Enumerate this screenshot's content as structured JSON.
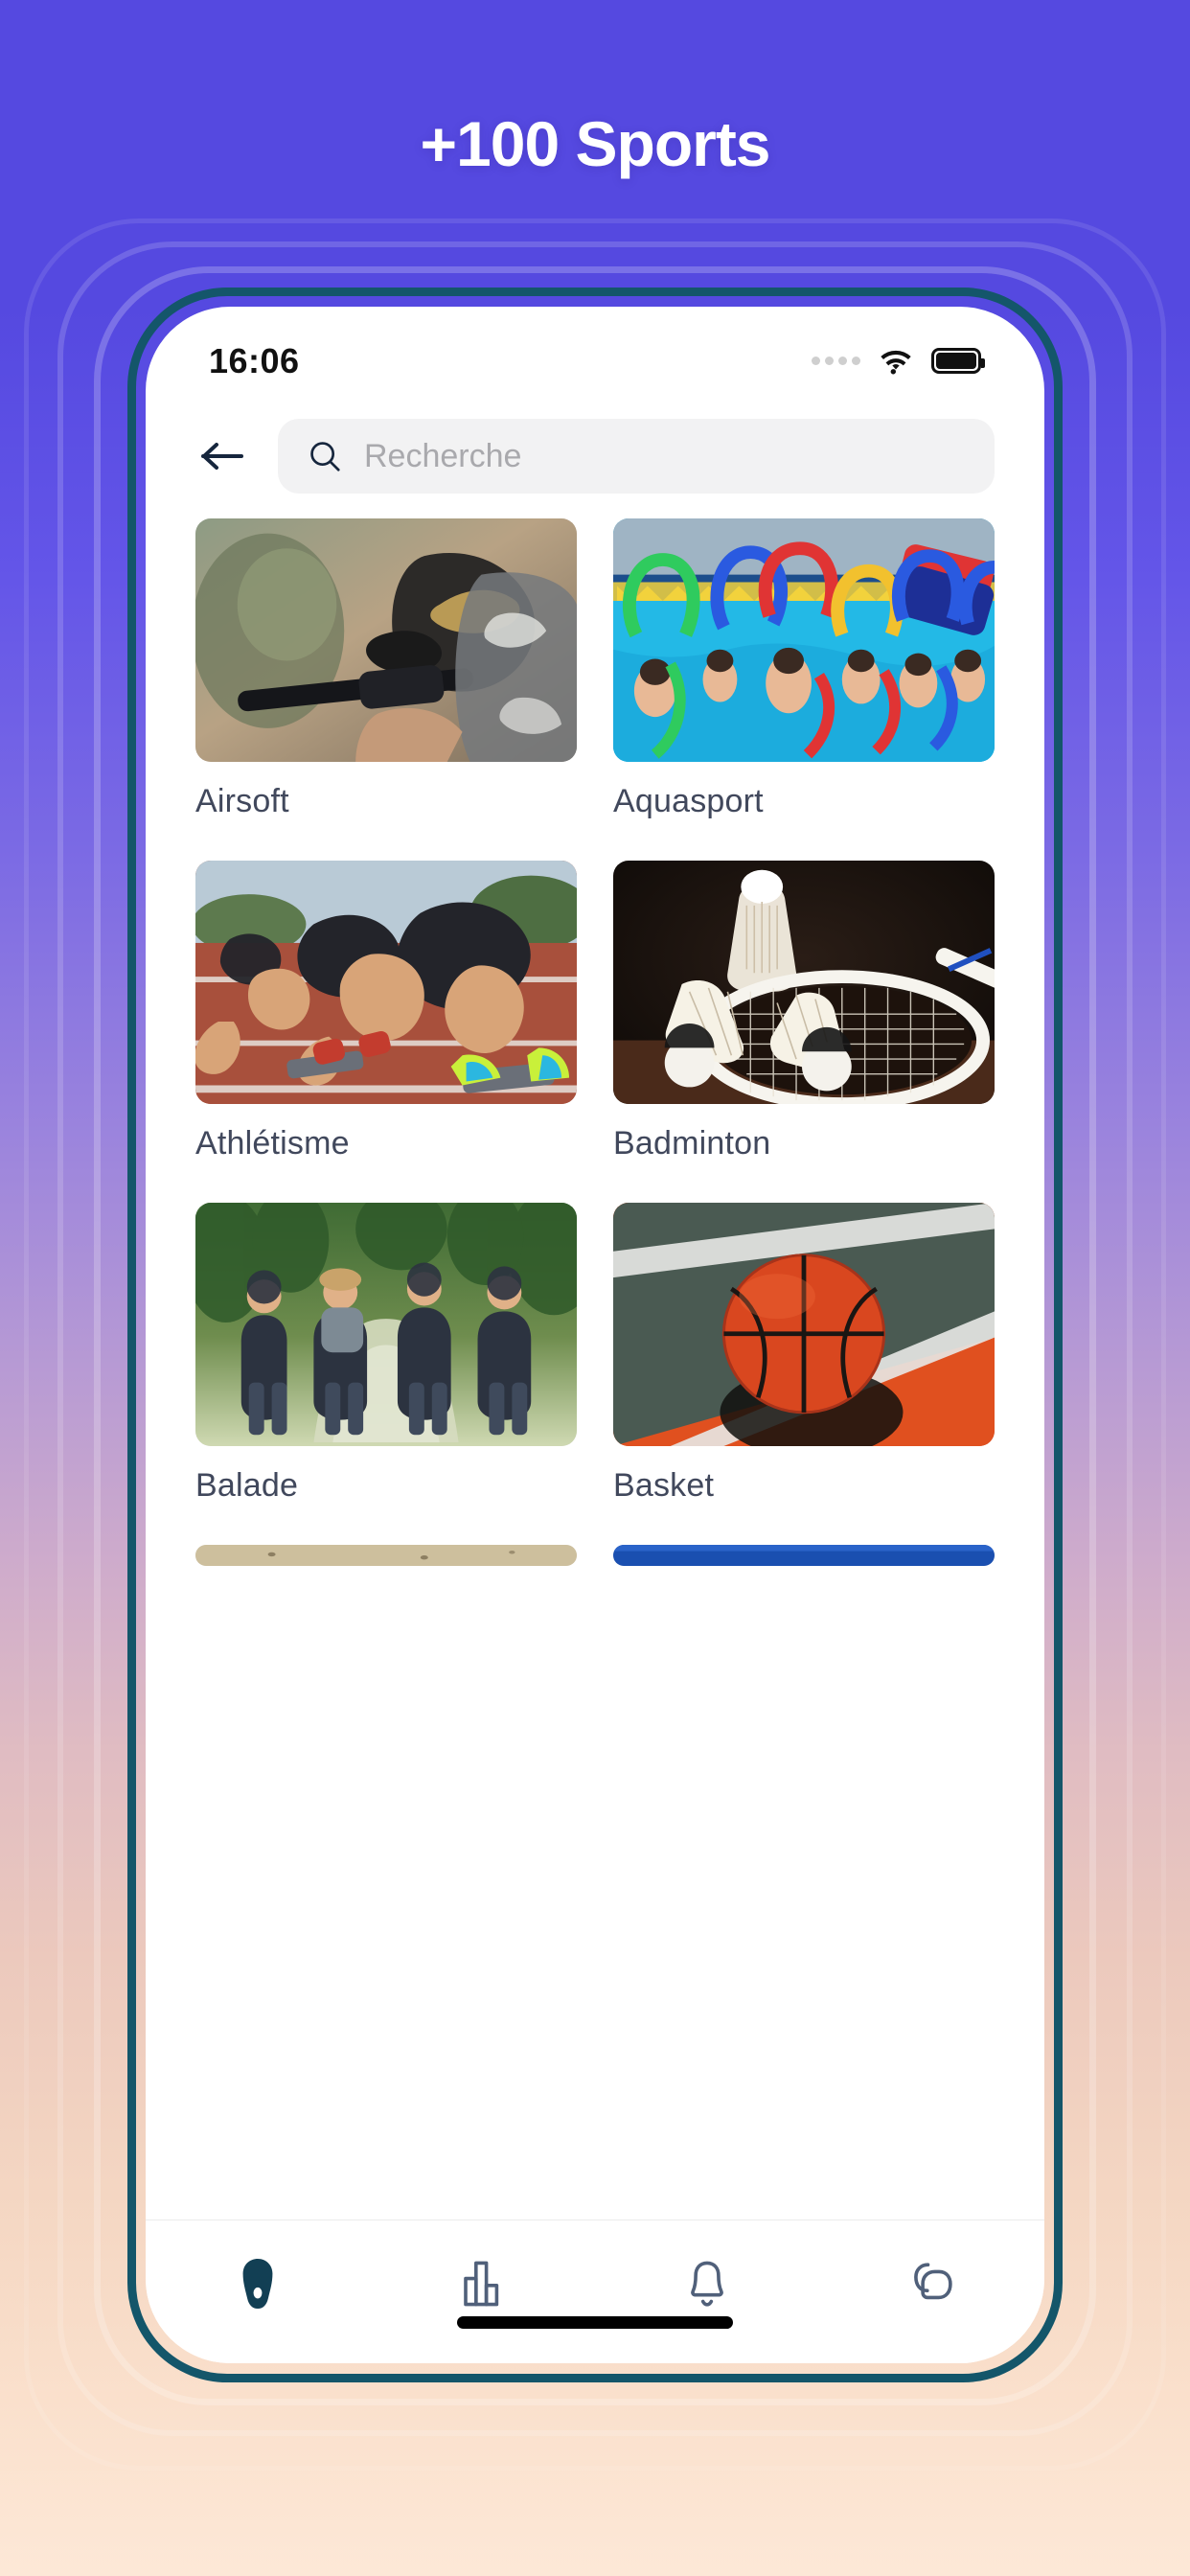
{
  "promo": {
    "headline": "+100 Sports",
    "background_top_color": "#5549E0",
    "background_bottom_color": "#FDE8D7",
    "phone_frame_color": "#14566A"
  },
  "status_bar": {
    "time": "16:06",
    "signal_icon": "signal-dots-icon",
    "wifi_icon": "wifi-icon",
    "battery_icon": "battery-full-icon"
  },
  "header": {
    "back_icon": "arrow-left-icon",
    "search": {
      "icon": "search-icon",
      "value": "",
      "placeholder": "Recherche"
    }
  },
  "sports_grid": {
    "items": [
      {
        "label": "Airsoft",
        "image": "paintball-player-photo"
      },
      {
        "label": "Aquasport",
        "image": "aqua-aerobics-pool-photo"
      },
      {
        "label": "Athlétisme",
        "image": "sprinters-starting-blocks-photo"
      },
      {
        "label": "Badminton",
        "image": "shuttlecocks-racket-photo"
      },
      {
        "label": "Balade",
        "image": "friends-walking-forest-photo"
      },
      {
        "label": "Basket",
        "image": "basketball-on-court-photo"
      }
    ]
  },
  "tabbar": {
    "items": [
      {
        "icon": "home-icon",
        "active": true
      },
      {
        "icon": "bar-chart-icon",
        "active": false
      },
      {
        "icon": "bell-icon",
        "active": false
      },
      {
        "icon": "chat-bubbles-icon",
        "active": false
      }
    ],
    "active_color": "#123F54",
    "inactive_color": "#50607A"
  }
}
